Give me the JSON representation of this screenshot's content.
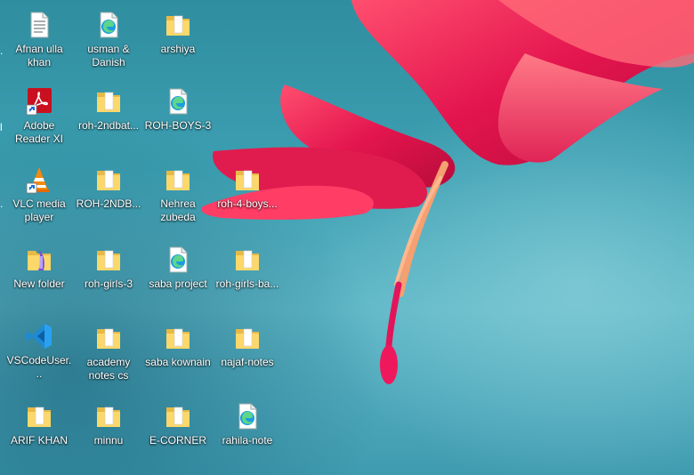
{
  "desktop": {
    "columns": [
      {
        "icons": [
          {
            "label": "Afnan ulla khan",
            "icon": "text-document-icon"
          },
          {
            "label": "Adobe Reader XI",
            "icon": "adobe-reader-shortcut-icon"
          },
          {
            "label": "VLC media player",
            "icon": "vlc-shortcut-icon"
          },
          {
            "label": "New folder",
            "icon": "folder-icon"
          },
          {
            "label": "VSCodeUser...",
            "icon": "vscode-icon"
          },
          {
            "label": "ARIF KHAN",
            "icon": "folder-icon"
          }
        ]
      },
      {
        "icons": [
          {
            "label": "usman & Danish",
            "icon": "edge-document-icon"
          },
          {
            "label": "roh-2ndbat...",
            "icon": "folder-icon"
          },
          {
            "label": "ROH-2NDB...",
            "icon": "folder-icon"
          },
          {
            "label": "roh-girls-3",
            "icon": "folder-icon"
          },
          {
            "label": "academy notes cs",
            "icon": "folder-icon"
          },
          {
            "label": "minnu",
            "icon": "folder-icon"
          }
        ]
      },
      {
        "icons": [
          {
            "label": "arshiya",
            "icon": "folder-icon"
          },
          {
            "label": "ROH-BOYS-3",
            "icon": "edge-document-icon"
          },
          {
            "label": "Nehrea zubeda",
            "icon": "folder-icon"
          },
          {
            "label": "saba project",
            "icon": "edge-document-icon"
          },
          {
            "label": "saba kownain",
            "icon": "folder-icon"
          },
          {
            "label": "E-CORNER",
            "icon": "folder-icon"
          }
        ]
      },
      {
        "icons": [
          {
            "label": "roh-4-boys...",
            "icon": "folder-icon"
          },
          {
            "label": "roh-girls-ba...",
            "icon": "folder-icon"
          },
          {
            "label": "najaf-notes",
            "icon": "folder-icon"
          },
          {
            "label": "rahila-note",
            "icon": "edge-document-icon"
          }
        ]
      }
    ],
    "edge_fragments": [
      ".",
      "l",
      "."
    ]
  }
}
